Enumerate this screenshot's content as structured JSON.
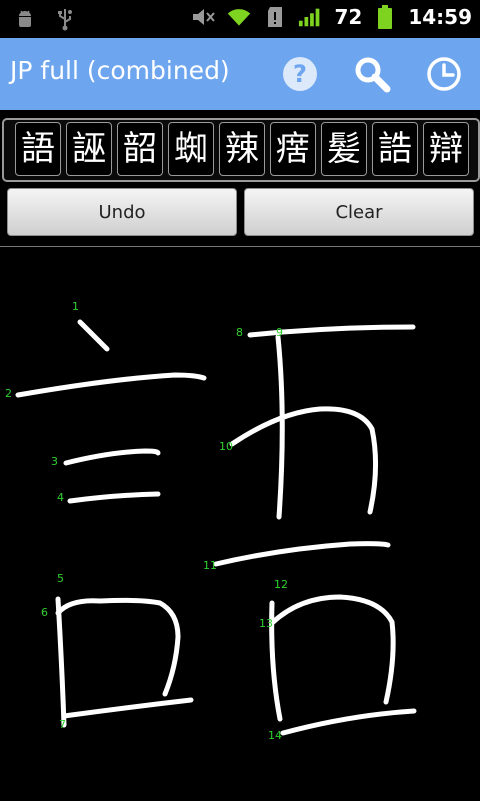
{
  "status_bar": {
    "battery_level": "72",
    "time": "14:59",
    "icons": [
      "android-debug-icon",
      "usb-icon",
      "mute-icon",
      "wifi-icon",
      "sd-card-icon",
      "signal-icon",
      "battery-icon"
    ]
  },
  "app": {
    "title": "JP full (combined)",
    "header_color": "#6da5ee",
    "actions": [
      "help-icon",
      "search-icon",
      "history-icon"
    ]
  },
  "candidates": [
    "語",
    "誣",
    "韶",
    "蜘",
    "辣",
    "瘔",
    "髪",
    "誥",
    "辯"
  ],
  "buttons": {
    "undo_label": "Undo",
    "clear_label": "Clear"
  },
  "stroke_labels": [
    "1",
    "2",
    "3",
    "4",
    "5",
    "6",
    "7",
    "8",
    "9",
    "10",
    "11",
    "12",
    "13",
    "14"
  ],
  "colors": {
    "stroke": "#ffffff",
    "stroke_label": "#2fd12f"
  }
}
